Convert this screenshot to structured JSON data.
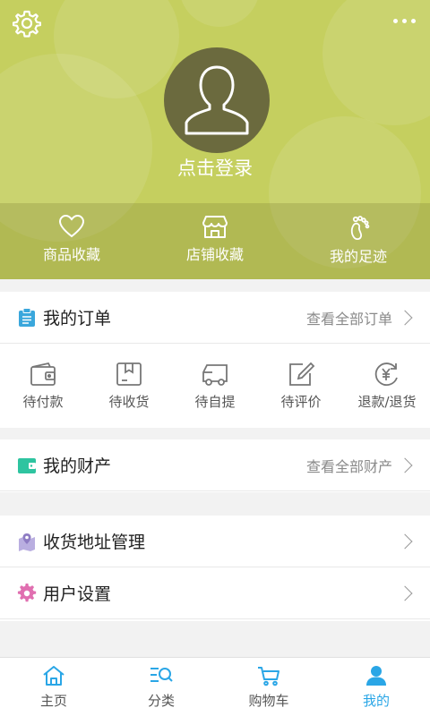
{
  "header": {
    "login_text": "点击登录",
    "favorites": [
      {
        "label": "商品收藏",
        "icon": "heart-icon"
      },
      {
        "label": "店铺收藏",
        "icon": "shop-icon"
      },
      {
        "label": "我的足迹",
        "icon": "footprint-icon"
      }
    ]
  },
  "orders": {
    "title": "我的订单",
    "more": "查看全部订单",
    "statuses": [
      {
        "label": "待付款",
        "icon": "wallet-icon"
      },
      {
        "label": "待收货",
        "icon": "package-icon"
      },
      {
        "label": "待自提",
        "icon": "truck-icon"
      },
      {
        "label": "待评价",
        "icon": "edit-icon"
      },
      {
        "label": "退款/退货",
        "icon": "refund-icon"
      }
    ]
  },
  "assets": {
    "title": "我的财产",
    "more": "查看全部财产"
  },
  "menu": {
    "address": "收货地址管理",
    "settings": "用户设置"
  },
  "nav": [
    {
      "label": "主页",
      "icon": "home-icon"
    },
    {
      "label": "分类",
      "icon": "category-icon"
    },
    {
      "label": "购物车",
      "icon": "cart-icon"
    },
    {
      "label": "我的",
      "icon": "user-icon",
      "active": true
    }
  ],
  "colors": {
    "header_bg": "#c5cf5f",
    "accent": "#2aa6e6",
    "order_icon": "#3aa7dc",
    "asset_icon": "#2ec4a0",
    "address_icon": "#8e7cc3",
    "settings_icon": "#e06fb0"
  }
}
